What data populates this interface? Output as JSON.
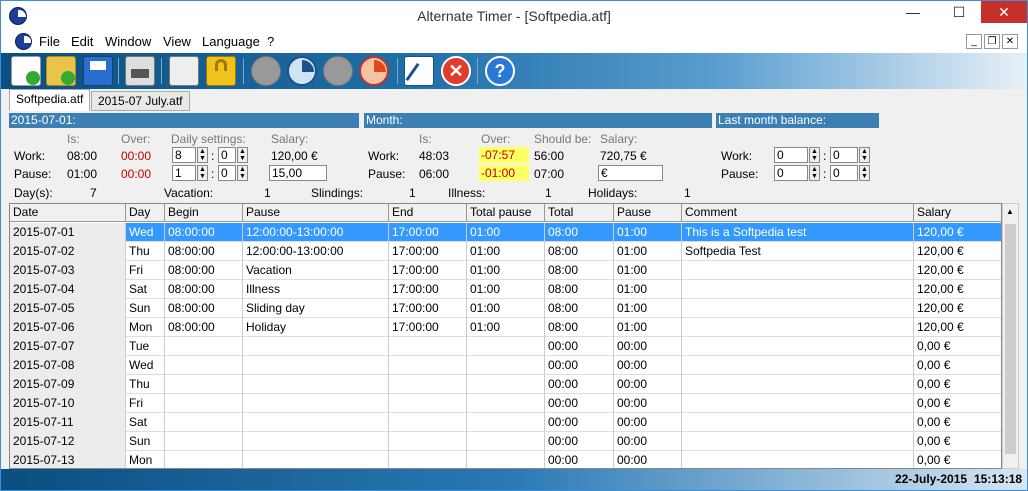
{
  "window": {
    "title": "Alternate Timer - [Softpedia.atf]",
    "minimize": "—",
    "maximize": "☐",
    "close": "✕"
  },
  "menu": [
    "File",
    "Edit",
    "Window",
    "View",
    "Language",
    "?"
  ],
  "mdi": {
    "minimize": "_",
    "restore": "❐",
    "close": "✕"
  },
  "tabs": [
    "Softpedia.atf",
    "2015-07 July.atf"
  ],
  "day_panel": {
    "title": "2015-07-01:",
    "is": "Is:",
    "over": "Over:",
    "daily": "Daily settings:",
    "salary": "Salary:",
    "work_label": "Work:",
    "work_is": "08:00",
    "work_over": "00:00",
    "work_h": "8",
    "work_m": "0",
    "work_salary": "120,00 €",
    "pause_label": "Pause:",
    "pause_is": "01:00",
    "pause_over": "00:00",
    "pause_h": "1",
    "pause_m": "0",
    "pause_salary": "15,00"
  },
  "month_panel": {
    "title": "Month:",
    "is": "Is:",
    "over": "Over:",
    "should": "Should be:",
    "salary": "Salary:",
    "work_label": "Work:",
    "work_is": "48:03",
    "work_over": "-07:57",
    "work_should": "56:00",
    "work_salary": "720,75 €",
    "pause_label": "Pause:",
    "pause_is": "06:00",
    "pause_over": "-01:00",
    "pause_should": "07:00",
    "pause_salary": "€"
  },
  "balance_panel": {
    "title": "Last month balance:",
    "work_label": "Work:",
    "work_h": "0",
    "work_m": "0",
    "pause_label": "Pause:",
    "pause_h": "0",
    "pause_m": "0"
  },
  "summary": {
    "days_label": "Day(s):",
    "days": "7",
    "vac_label": "Vacation:",
    "vac": "1",
    "sli_label": "Slindings:",
    "sli": "1",
    "ill_label": "Illness:",
    "ill": "1",
    "hol_label": "Holidays:",
    "hol": "1"
  },
  "table": {
    "headers": [
      "Date",
      "Day",
      "Begin",
      "Pause",
      "End",
      "Total pause",
      "Total",
      "Pause",
      "Comment",
      "Salary"
    ],
    "rows": [
      [
        "2015-07-01",
        "Wed",
        "08:00:00",
        "12:00:00-13:00:00",
        "17:00:00",
        "01:00",
        "08:00",
        "01:00",
        "This is a Softpedia test",
        "120,00 €"
      ],
      [
        "2015-07-02",
        "Thu",
        "08:00:00",
        "12:00:00-13:00:00",
        "17:00:00",
        "01:00",
        "08:00",
        "01:00",
        "Softpedia Test",
        "120,00 €"
      ],
      [
        "2015-07-03",
        "Fri",
        "08:00:00",
        "Vacation",
        "17:00:00",
        "01:00",
        "08:00",
        "01:00",
        "",
        "120,00 €"
      ],
      [
        "2015-07-04",
        "Sat",
        "08:00:00",
        "Illness",
        "17:00:00",
        "01:00",
        "08:00",
        "01:00",
        "",
        "120,00 €"
      ],
      [
        "2015-07-05",
        "Sun",
        "08:00:00",
        "Sliding day",
        "17:00:00",
        "01:00",
        "08:00",
        "01:00",
        "",
        "120,00 €"
      ],
      [
        "2015-07-06",
        "Mon",
        "08:00:00",
        "Holiday",
        "17:00:00",
        "01:00",
        "08:00",
        "01:00",
        "",
        "120,00 €"
      ],
      [
        "2015-07-07",
        "Tue",
        "",
        "",
        "",
        "",
        "00:00",
        "00:00",
        "",
        "0,00 €"
      ],
      [
        "2015-07-08",
        "Wed",
        "",
        "",
        "",
        "",
        "00:00",
        "00:00",
        "",
        "0,00 €"
      ],
      [
        "2015-07-09",
        "Thu",
        "",
        "",
        "",
        "",
        "00:00",
        "00:00",
        "",
        "0,00 €"
      ],
      [
        "2015-07-10",
        "Fri",
        "",
        "",
        "",
        "",
        "00:00",
        "00:00",
        "",
        "0,00 €"
      ],
      [
        "2015-07-11",
        "Sat",
        "",
        "",
        "",
        "",
        "00:00",
        "00:00",
        "",
        "0,00 €"
      ],
      [
        "2015-07-12",
        "Sun",
        "",
        "",
        "",
        "",
        "00:00",
        "00:00",
        "",
        "0,00 €"
      ],
      [
        "2015-07-13",
        "Mon",
        "",
        "",
        "",
        "",
        "00:00",
        "00:00",
        "",
        "0,00 €"
      ]
    ]
  },
  "status": {
    "date": "22-July-2015",
    "time": "15:13:18"
  }
}
